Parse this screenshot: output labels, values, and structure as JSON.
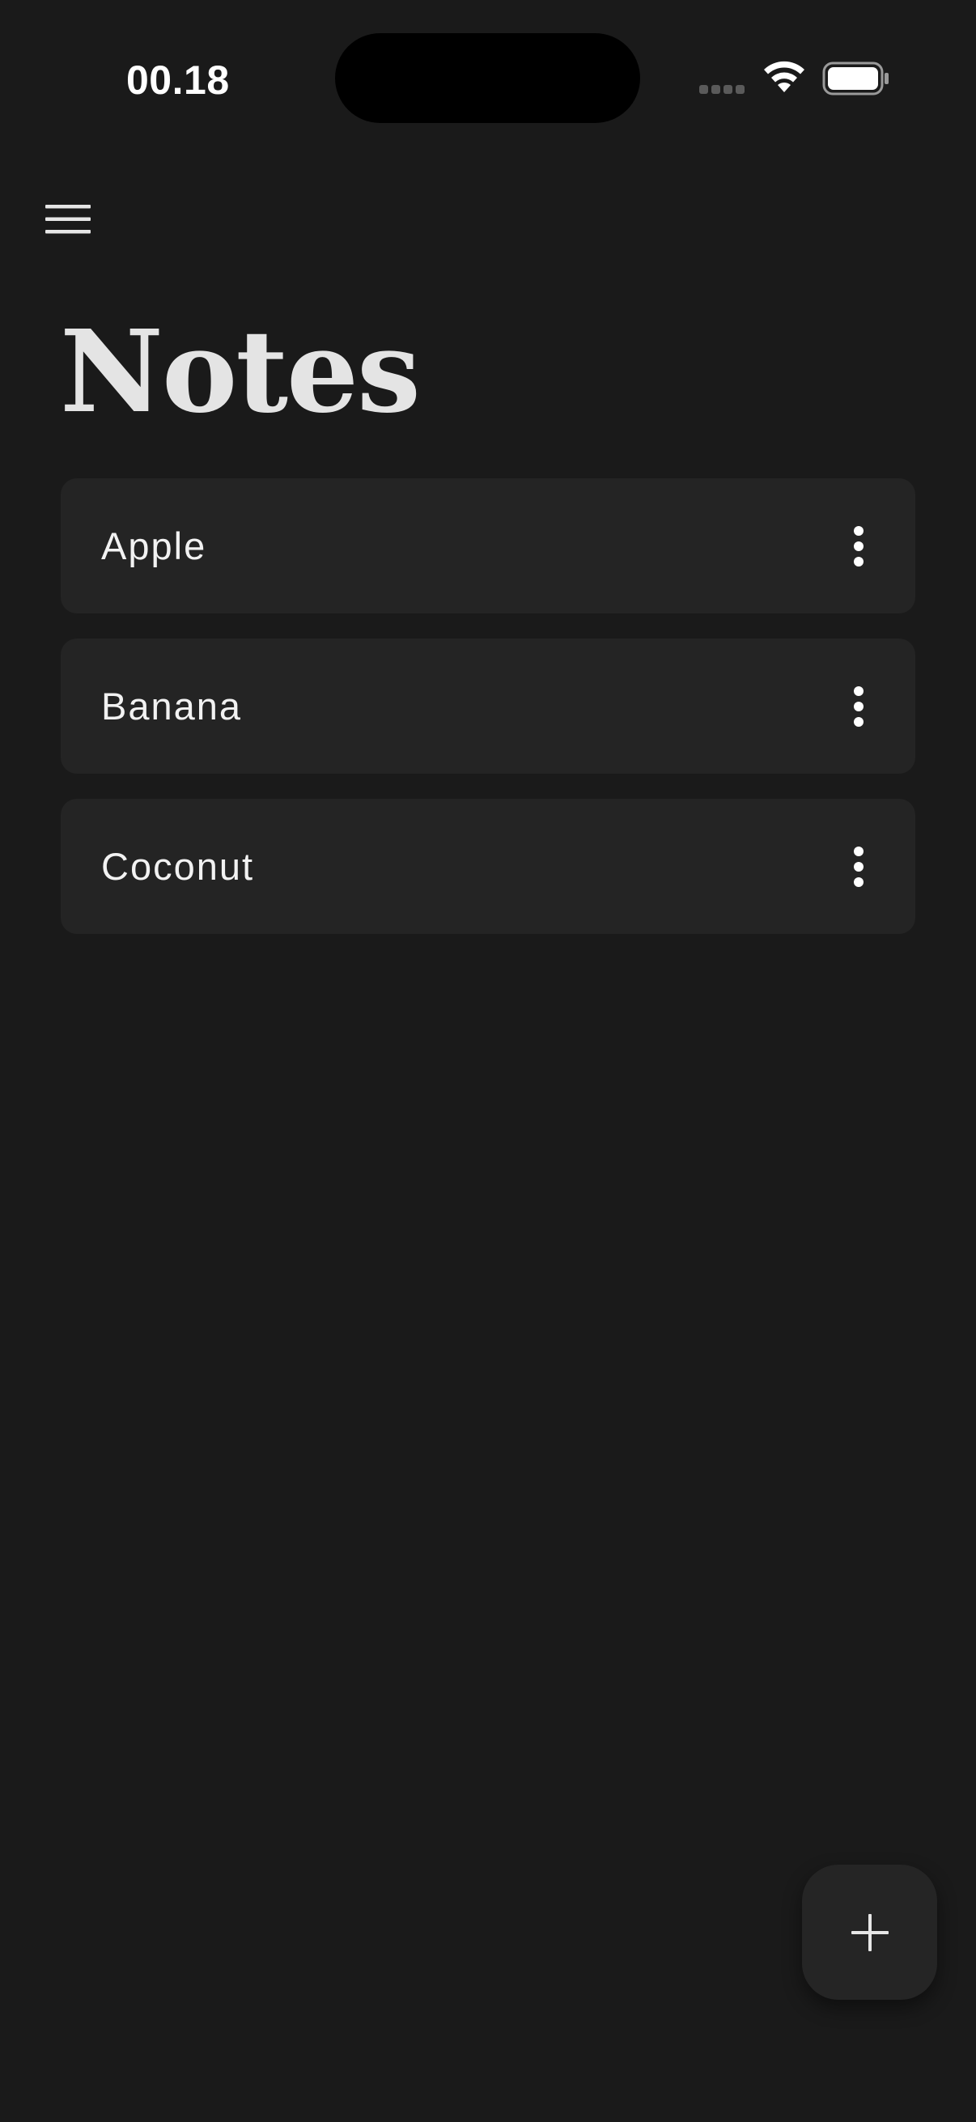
{
  "status_bar": {
    "time": "00.18",
    "icons": [
      "cellular-signal-icon",
      "wifi-icon",
      "battery-icon"
    ]
  },
  "header": {
    "menu_icon": "hamburger-menu-icon",
    "title": "Notes"
  },
  "notes": [
    {
      "title": "Apple",
      "menu_icon": "more-vertical-icon"
    },
    {
      "title": "Banana",
      "menu_icon": "more-vertical-icon"
    },
    {
      "title": "Coconut",
      "menu_icon": "more-vertical-icon"
    }
  ],
  "fab": {
    "icon": "plus-icon"
  },
  "colors": {
    "background": "#1a1a1a",
    "card": "#242424",
    "title_text": "#e4e4e4",
    "text": "#f2f2f2"
  }
}
